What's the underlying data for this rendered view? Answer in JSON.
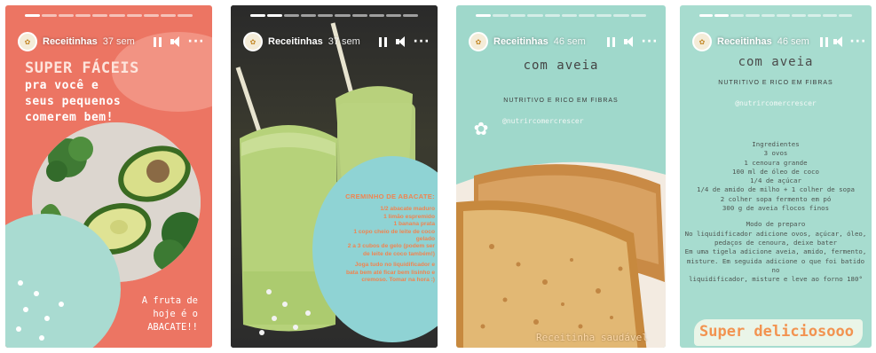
{
  "colors": {
    "story1_bg": "#ec7563",
    "story2_bg": "#1a1a1a",
    "story3_bg": "#9fd8cb",
    "story4_bg": "#a7dccf",
    "accent_orange": "#f08450"
  },
  "icons": {
    "pause": "pause-icon",
    "mute": "speaker-mute-icon",
    "more": "more-dots-icon",
    "avatar": "avatar-icon"
  },
  "stories": [
    {
      "username": "Receitinhas",
      "time": "37 sem",
      "progress_segments": 10,
      "progress_done": 1,
      "title_line1": "SUPER FÁCEIS",
      "title_line2": "pra você e",
      "title_line3": "seus pequenos",
      "title_line4": "comerem bem!",
      "caption_line1": "A fruta de",
      "caption_line2": "hoje é o",
      "caption_line3": "ABACATE!!"
    },
    {
      "username": "Receitinhas",
      "time": "37 sem",
      "progress_segments": 10,
      "progress_done": 2,
      "recipe_title": "CREMINHO DE ABACATE:",
      "ingredients": [
        "1/2 abacate maduro",
        "1 limão espremido",
        "1 banana prata",
        "1 copo cheio de leite de coco",
        "gelado",
        "2 a 3 cubos de gelo (podem ser",
        "de leite de coco também!)"
      ],
      "instructions": [
        "Joga tudo no liquidificador e",
        "bata bem até ficar bem lisinho e",
        "cremoso. Tomar na hora :)"
      ]
    },
    {
      "username": "Receitinhas",
      "time": "46 sem",
      "progress_segments": 10,
      "progress_done": 1,
      "title": "com aveia",
      "subtitle": "NUTRITIVO E RICO EM FIBRAS",
      "handle": "@nutrircomercrescer",
      "caption": "Receitinha saudável"
    },
    {
      "username": "Receitinhas",
      "time": "46 sem",
      "progress_segments": 10,
      "progress_done": 2,
      "title": "com aveia",
      "subtitle": "NUTRITIVO E RICO EM FIBRAS",
      "handle": "@nutrircomercrescer",
      "ingredients_title": "Ingredientes",
      "ingredients": [
        "3 ovos",
        "1 cenoura grande",
        "100 ml de óleo de coco",
        "1/4 de açúcar",
        "1/4 de amido de milho + 1 colher de sopa",
        "2 colher sopa fermento em pó",
        "300 g de aveia flocos finos"
      ],
      "method_title": "Modo de preparo",
      "method": [
        "No liquidificador adicione ovos, açúcar, óleo,",
        "pedaços de cenoura, deixe bater",
        "Em uma tigela adicione aveia, amido, fermento,",
        "misture. Em seguida adicione o que foi batido no",
        "liquidificador, misture e leve ao forno 180°"
      ],
      "banner": "Super deliciosooo"
    }
  ]
}
